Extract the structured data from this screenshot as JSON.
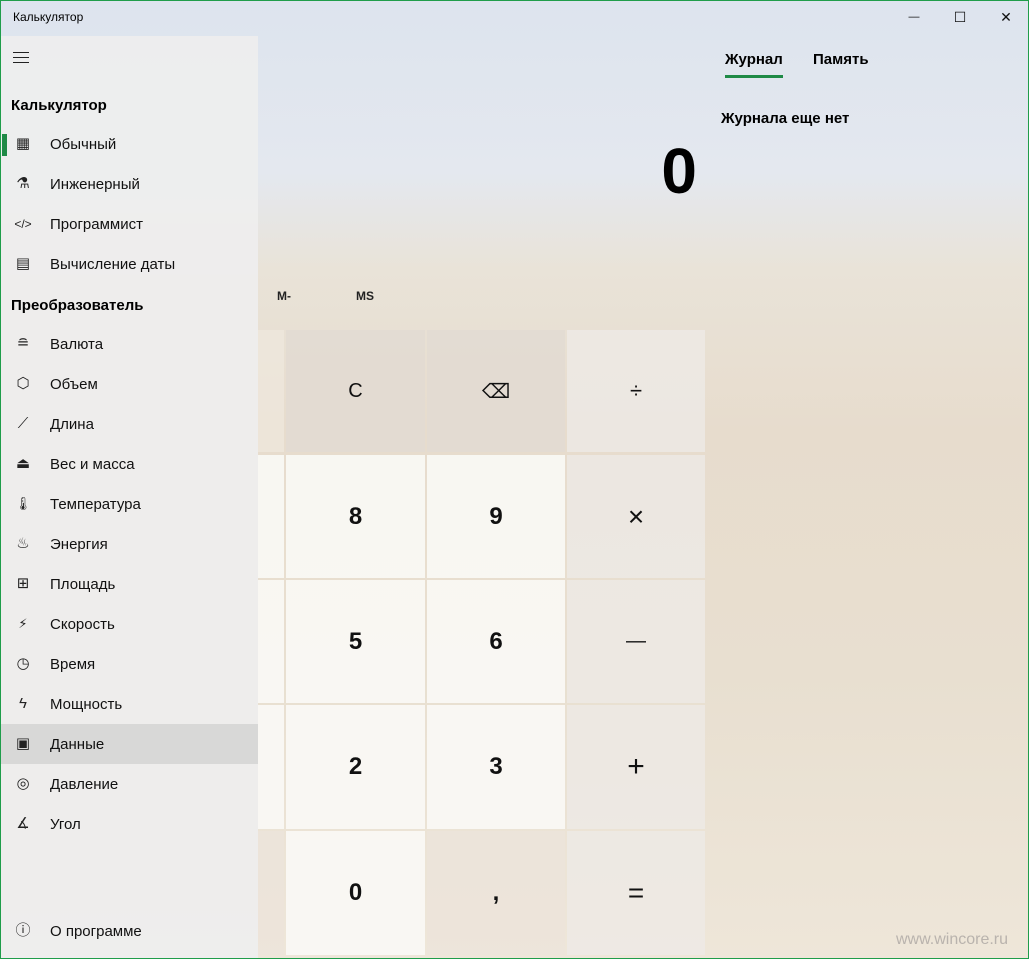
{
  "window": {
    "title": "Калькулятор",
    "minimize_glyph": "—",
    "maximize_glyph": "☐",
    "close_glyph": "✕",
    "accent_color": "#1f8a46"
  },
  "sidebar": {
    "menu_icon": "hamburger-icon",
    "section_calculator": "Калькулятор",
    "calculator_items": [
      {
        "label": "Обычный",
        "icon": "calculator-icon",
        "glyph": "▦"
      },
      {
        "label": "Инженерный",
        "icon": "flask-icon",
        "glyph": "⚗"
      },
      {
        "label": "Программист",
        "icon": "code-icon",
        "glyph": "</>"
      },
      {
        "label": "Вычисление даты",
        "icon": "calendar-icon",
        "glyph": "▤"
      }
    ],
    "section_converter": "Преобразователь",
    "converter_items": [
      {
        "label": "Валюта",
        "icon": "coins-icon",
        "glyph": "≘"
      },
      {
        "label": "Объем",
        "icon": "cube-icon",
        "glyph": "⬡"
      },
      {
        "label": "Длина",
        "icon": "ruler-icon",
        "glyph": "⟋"
      },
      {
        "label": "Вес и масса",
        "icon": "weight-icon",
        "glyph": "⏏"
      },
      {
        "label": "Температура",
        "icon": "thermometer-icon",
        "glyph": "🌡"
      },
      {
        "label": "Энергия",
        "icon": "flame-icon",
        "glyph": "♨"
      },
      {
        "label": "Площадь",
        "icon": "grid-icon",
        "glyph": "⊞"
      },
      {
        "label": "Скорость",
        "icon": "running-icon",
        "glyph": "⚡"
      },
      {
        "label": "Время",
        "icon": "clock-icon",
        "glyph": "◷"
      },
      {
        "label": "Мощность",
        "icon": "bolt-icon",
        "glyph": "ϟ"
      },
      {
        "label": "Данные",
        "icon": "storage-icon",
        "glyph": "▣"
      },
      {
        "label": "Давление",
        "icon": "gauge-icon",
        "glyph": "◎"
      },
      {
        "label": "Угол",
        "icon": "angle-icon",
        "glyph": "∡"
      }
    ],
    "about": {
      "label": "О программе",
      "icon": "info-icon",
      "glyph": "ⓘ"
    }
  },
  "history_panel": {
    "tab_history": "Журнал",
    "tab_memory": "Память",
    "empty_text": "Журнала еще нет"
  },
  "display": {
    "value": "0"
  },
  "memory": {
    "minus": "M-",
    "store": "MS"
  },
  "keypad": {
    "clear": "C",
    "backspace": "⌫",
    "divide": "÷",
    "multiply": "×",
    "minus": "—",
    "plus": "+",
    "equals": "=",
    "k8": "8",
    "k9": "9",
    "k5": "5",
    "k6": "6",
    "k2": "2",
    "k3": "3",
    "k0": "0",
    "decimal": ","
  },
  "watermark": "www.wincore.ru"
}
